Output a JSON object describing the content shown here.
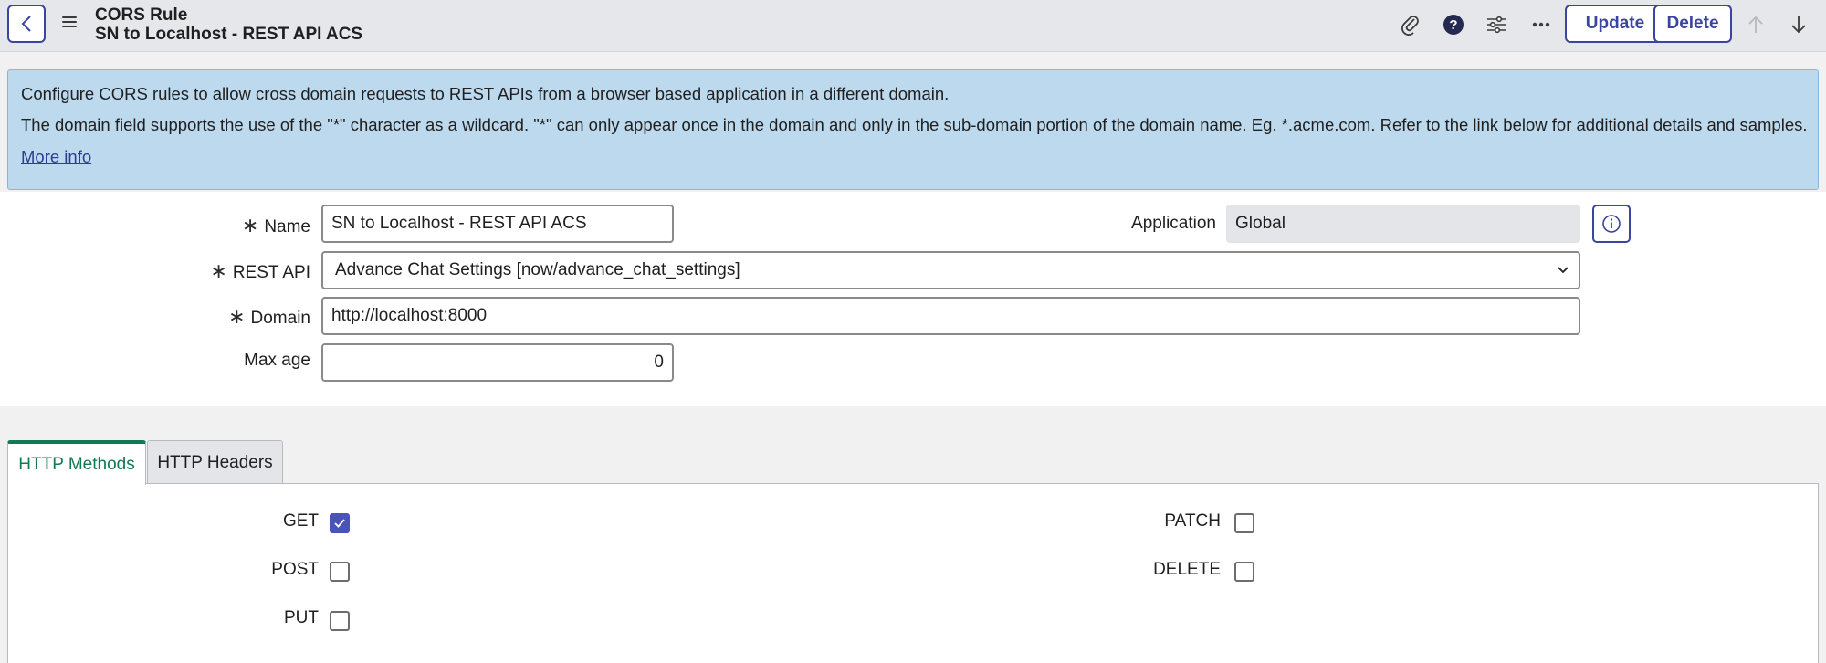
{
  "header": {
    "record_type": "CORS Rule",
    "record_name": "SN to Localhost - REST API ACS",
    "update_label": "Update",
    "delete_label": "Delete"
  },
  "banner": {
    "line1": "Configure CORS rules to allow cross domain requests to REST APIs from a browser based application in a different domain.",
    "line2": "The domain field supports the use of the \"*\" character as a wildcard. \"*\" can only appear once in the domain and only in the sub-domain portion of the domain name. Eg. *.acme.com. Refer to the link below for additional details and samples.",
    "more_info": "More info"
  },
  "form": {
    "name_label": "Name",
    "name_value": "SN to Localhost - REST API ACS",
    "application_label": "Application",
    "application_value": "Global",
    "rest_api_label": "REST API",
    "rest_api_value": "Advance Chat Settings [now/advance_chat_settings]",
    "domain_label": "Domain",
    "domain_value": "http://localhost:8000",
    "max_age_label": "Max age",
    "max_age_value": "0"
  },
  "tabs": [
    {
      "label": "HTTP Methods",
      "active": true
    },
    {
      "label": "HTTP Headers",
      "active": false
    }
  ],
  "methods": {
    "get": {
      "label": "GET",
      "checked": true
    },
    "post": {
      "label": "POST",
      "checked": false
    },
    "put": {
      "label": "PUT",
      "checked": false
    },
    "patch": {
      "label": "PATCH",
      "checked": false
    },
    "delete": {
      "label": "DELETE",
      "checked": false
    }
  },
  "colors": {
    "accent": "#3b45a0",
    "active_tab": "#117a55",
    "banner_bg": "#bcd9ee",
    "checkbox_checked": "#4a53b8"
  },
  "icons": [
    "back-arrow-icon",
    "hamburger-menu-icon",
    "paperclip-icon",
    "help-icon",
    "sliders-icon",
    "more-options-icon",
    "arrow-up-icon",
    "arrow-down-icon",
    "info-icon",
    "chevron-down-icon",
    "checkmark-icon"
  ]
}
